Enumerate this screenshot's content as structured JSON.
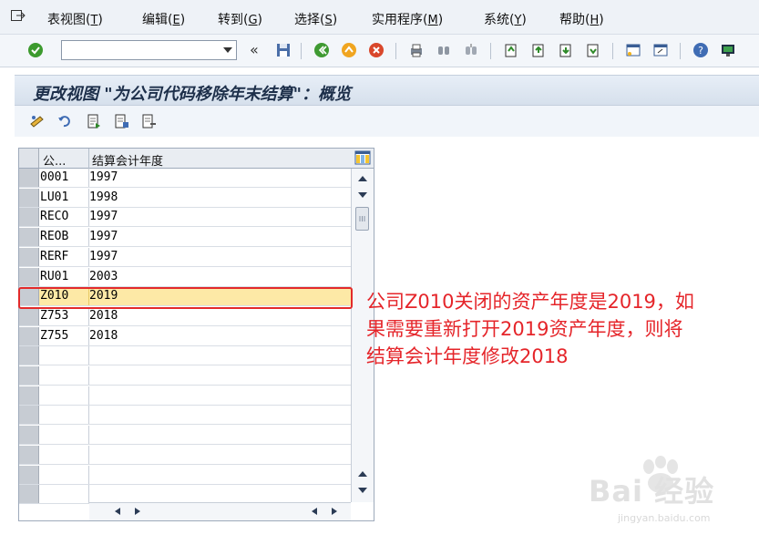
{
  "menu": {
    "items": [
      {
        "label": "表视图(",
        "key": "T",
        "tail": ")"
      },
      {
        "label": "编辑(",
        "key": "E",
        "tail": ")"
      },
      {
        "label": "转到(",
        "key": "G",
        "tail": ")"
      },
      {
        "label": "选择(",
        "key": "S",
        "tail": ")"
      },
      {
        "label": "实用程序(",
        "key": "M",
        "tail": ")"
      },
      {
        "label": "系统(",
        "key": "Y",
        "tail": ")"
      },
      {
        "label": "帮助(",
        "key": "H",
        "tail": ")"
      }
    ]
  },
  "toolbar": {
    "command_value": "",
    "history_glyph": "«"
  },
  "page": {
    "title": "更改视图 \"为公司代码移除年末结算\"：概览"
  },
  "table": {
    "columns": [
      "公...",
      "结算会计年度"
    ],
    "rows": [
      {
        "company": "0001",
        "year": "1997"
      },
      {
        "company": "LU01",
        "year": "1998"
      },
      {
        "company": "RECO",
        "year": "1997"
      },
      {
        "company": "REOB",
        "year": "1997"
      },
      {
        "company": "RERF",
        "year": "1997"
      },
      {
        "company": "RU01",
        "year": "2003"
      },
      {
        "company": "Z010",
        "year": "2019"
      },
      {
        "company": "Z753",
        "year": "2018"
      },
      {
        "company": "Z755",
        "year": "2018"
      }
    ],
    "highlighted_row": 6
  },
  "annotation": {
    "lines": [
      "公司Z010关闭的资产年度是2019，如",
      "果需要重新打开2019资产年度，则将",
      "结算会计年度修改2018"
    ],
    "color": "#e5252a"
  },
  "watermark": {
    "text": "Bai 经验",
    "sub": "jingyan.baidu.com"
  },
  "colors": {
    "highlight_row": "#fde9a6",
    "annotation_box": "#e32a2a"
  }
}
